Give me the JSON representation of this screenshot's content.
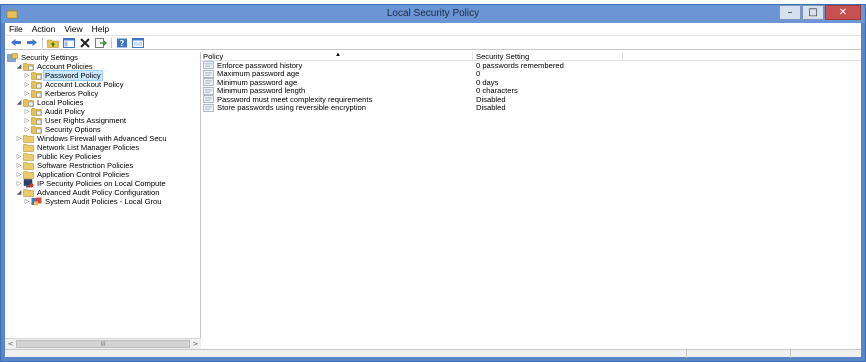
{
  "window": {
    "title": "Local Security Policy",
    "controls": {
      "minimize": "–",
      "maximize": "□",
      "close": "✕"
    }
  },
  "menu": [
    "File",
    "Action",
    "View",
    "Help"
  ],
  "toolbar": {
    "icons": [
      "back-icon",
      "forward-icon",
      "up-folder-icon",
      "show-hide-tree-icon",
      "delete-icon",
      "export-list-icon",
      "help-icon",
      "properties-icon"
    ]
  },
  "tree": [
    {
      "label": "Security Settings",
      "level": 0,
      "expander": "",
      "icon": "security-settings-icon"
    },
    {
      "label": "Account Policies",
      "level": 1,
      "expander": "expanded",
      "icon": "folder-policy-icon"
    },
    {
      "label": "Password Policy",
      "level": 2,
      "expander": "collapsed",
      "icon": "folder-policy-icon",
      "selected": true
    },
    {
      "label": "Account Lockout Policy",
      "level": 2,
      "expander": "collapsed",
      "icon": "folder-policy-icon"
    },
    {
      "label": "Kerberos Policy",
      "level": 2,
      "expander": "collapsed",
      "icon": "folder-policy-icon"
    },
    {
      "label": "Local Policies",
      "level": 1,
      "expander": "expanded",
      "icon": "folder-policy-icon"
    },
    {
      "label": "Audit Policy",
      "level": 2,
      "expander": "collapsed",
      "icon": "folder-policy-icon"
    },
    {
      "label": "User Rights Assignment",
      "level": 2,
      "expander": "collapsed",
      "icon": "folder-policy-icon"
    },
    {
      "label": "Security Options",
      "level": 2,
      "expander": "collapsed",
      "icon": "folder-policy-icon"
    },
    {
      "label": "Windows Firewall with Advanced Secu",
      "level": 1,
      "expander": "collapsed",
      "icon": "folder-icon"
    },
    {
      "label": "Network List Manager Policies",
      "level": 1,
      "expander": "",
      "icon": "folder-icon"
    },
    {
      "label": "Public Key Policies",
      "level": 1,
      "expander": "collapsed",
      "icon": "folder-icon"
    },
    {
      "label": "Software Restriction Policies",
      "level": 1,
      "expander": "collapsed",
      "icon": "folder-icon"
    },
    {
      "label": "Application Control Policies",
      "level": 1,
      "expander": "collapsed",
      "icon": "folder-icon"
    },
    {
      "label": "IP Security Policies on Local Compute",
      "level": 1,
      "expander": "collapsed",
      "icon": "ip-security-icon"
    },
    {
      "label": "Advanced Audit Policy Configuration",
      "level": 1,
      "expander": "expanded",
      "icon": "folder-icon"
    },
    {
      "label": "System Audit Policies - Local Grou",
      "level": 2,
      "expander": "collapsed",
      "icon": "audit-policies-icon"
    }
  ],
  "tree_scrollbar": {
    "left": "<",
    "thumb": "III",
    "right": ">"
  },
  "list": {
    "columns": [
      "Policy",
      "Security Setting"
    ],
    "sort_indicator": "▲",
    "rows": [
      {
        "policy": "Enforce password history",
        "setting": "0 passwords remembered"
      },
      {
        "policy": "Maximum password age",
        "setting": "0"
      },
      {
        "policy": "Minimum password age",
        "setting": "0 days"
      },
      {
        "policy": "Minimum password length",
        "setting": "0 characters"
      },
      {
        "policy": "Password must meet complexity requirements",
        "setting": "Disabled"
      },
      {
        "policy": "Store passwords using reversible encryption",
        "setting": "Disabled"
      }
    ]
  },
  "colors": {
    "window_frame": "#5a86c8",
    "titlebar": "#6b95d4",
    "close_button": "#c75050",
    "selection": "#cce8ff"
  }
}
